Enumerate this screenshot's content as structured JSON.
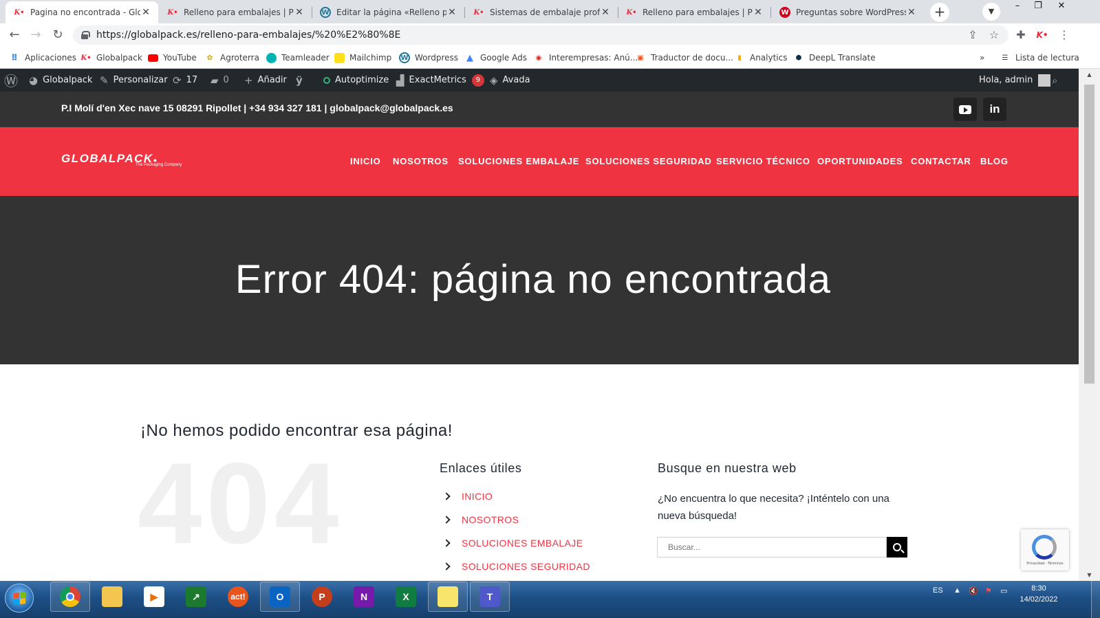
{
  "browser": {
    "tabs": [
      {
        "title": "Pagina no encontrada - Global",
        "icon": "globalpack-k-icon",
        "active": true
      },
      {
        "title": "Relleno para embalajes | Prote",
        "icon": "globalpack-k-icon",
        "active": false
      },
      {
        "title": "Editar la página «Relleno para",
        "icon": "wordpress-icon",
        "active": false
      },
      {
        "title": "Sistemas de embalaje profesio",
        "icon": "globalpack-k-icon",
        "active": false
      },
      {
        "title": "Relleno para embalajes | Prote",
        "icon": "globalpack-k-icon",
        "active": false
      },
      {
        "title": "Preguntas sobre WordPress – F",
        "icon": "wordpress-forum-icon",
        "active": false
      }
    ],
    "url": "https://globalpack.es/relleno-para-embalajes/%20%E2%80%8E",
    "bookmarks": [
      {
        "label": "Aplicaciones",
        "icon": "apps-grid-icon"
      },
      {
        "label": "Globalpack",
        "icon": "globalpack-k-icon"
      },
      {
        "label": "YouTube",
        "icon": "youtube-icon"
      },
      {
        "label": "Agroterra",
        "icon": "agroterra-icon"
      },
      {
        "label": "Teamleader",
        "icon": "teamleader-icon"
      },
      {
        "label": "Mailchimp",
        "icon": "mailchimp-icon"
      },
      {
        "label": "Wordpress",
        "icon": "wordpress-icon"
      },
      {
        "label": "Google Ads",
        "icon": "google-ads-icon"
      },
      {
        "label": "Interempresas: Anú...",
        "icon": "interempresas-icon"
      },
      {
        "label": "Traductor de docu...",
        "icon": "translator-icon"
      },
      {
        "label": "Analytics",
        "icon": "analytics-icon"
      },
      {
        "label": "DeepL Translate",
        "icon": "deepl-icon"
      }
    ],
    "more_bookmarks": "»",
    "reading_list": "Lista de lectura"
  },
  "adminbar": {
    "site": "Globalpack",
    "customize": "Personalizar",
    "updates": "17",
    "comments": "0",
    "add_new": "Añadir",
    "autoptimize": "Autoptimize",
    "exactmetrics": "ExactMetrics",
    "exactmetrics_count": "9",
    "avada": "Avada",
    "greeting": "Hola, admin"
  },
  "site": {
    "contact_line": "P.I Molí d'en Xec nave 15 08291 Ripollet | +34 934 327 181  |  globalpack@globalpack.es",
    "logo": "GLOBALPACK",
    "logo_tagline": "The Packaging Company",
    "nav": [
      "INICIO",
      "NOSOTROS",
      "SOLUCIONES EMBALAJE",
      "SOLUCIONES SEGURIDAD",
      "SERVICIO TÉCNICO",
      "OPORTUNIDADES",
      "CONTACTAR",
      "BLOG"
    ],
    "page_title": "Error 404: página no encontrada",
    "oops_heading": "¡No hemos podido encontrar esa página!",
    "big_404": "404",
    "links_heading": "Enlaces útiles",
    "useful_links": [
      "INICIO",
      "NOSOTROS",
      "SOLUCIONES EMBALAJE",
      "SOLUCIONES SEGURIDAD"
    ],
    "search_heading": "Busque en nuestra web",
    "search_text": "¿No encuentra lo que necesita? ¡Inténtelo con una nueva búsqueda!",
    "search_placeholder": "Buscar...",
    "recaptcha_text": "Privacidad - Términos"
  },
  "taskbar": {
    "language": "ES",
    "time": "8:30",
    "date": "14/02/2022",
    "apps": [
      "chrome-icon",
      "file-explorer-icon",
      "media-player-icon",
      "stock-chart-icon",
      "act-icon",
      "outlook-icon",
      "powerpoint-icon",
      "onenote-icon",
      "excel-icon",
      "sticky-notes-icon",
      "teams-icon"
    ]
  },
  "colors": {
    "brand_red": "#ef3341",
    "dark_bar": "#333333",
    "admin_bar": "#23282d"
  }
}
